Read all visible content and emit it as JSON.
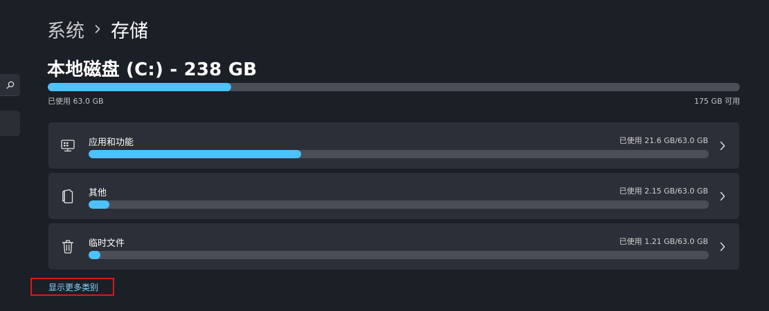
{
  "breadcrumb": {
    "parent": "系统",
    "current": "存储"
  },
  "disk": {
    "title": "本地磁盘 (C:) - 238 GB",
    "used_label": "已使用 63.0 GB",
    "free_label": "175 GB 可用",
    "used_fraction": 0.265
  },
  "categories": [
    {
      "label": "应用和功能",
      "usage": "已使用 21.6 GB/63.0 GB",
      "icon": "apps-features-icon",
      "fraction": 0.343
    },
    {
      "label": "其他",
      "usage": "已使用 2.15 GB/63.0 GB",
      "icon": "other-files-icon",
      "fraction": 0.034
    },
    {
      "label": "临时文件",
      "usage": "已使用 1.21 GB/63.0 GB",
      "icon": "trash-icon",
      "fraction": 0.019
    }
  ],
  "show_more_label": "显示更多类别",
  "colors": {
    "accent": "#4cc2ff",
    "track": "#4a4e57",
    "card": "#2b2f37",
    "background": "#1b1f26",
    "highlight_box": "#e0161b"
  }
}
